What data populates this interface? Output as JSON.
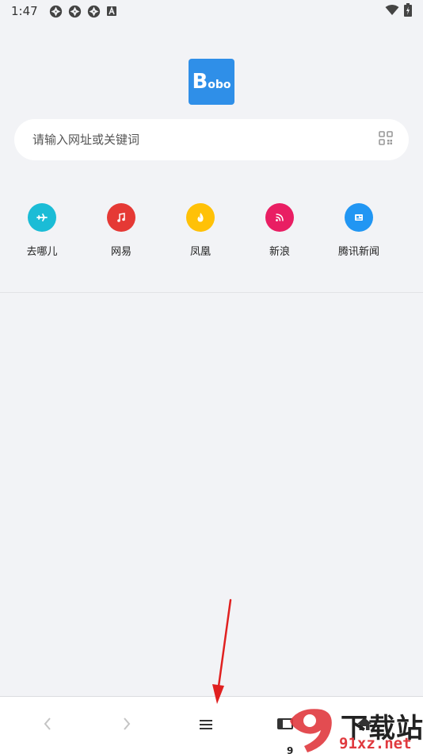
{
  "status_bar": {
    "time": "1:47",
    "left_icons": [
      "aperture-icon",
      "aperture-icon",
      "aperture-icon",
      "a-badge-icon"
    ],
    "right_icons": [
      "wifi-icon",
      "battery-charging-icon"
    ]
  },
  "logo": {
    "text_big": "B",
    "text_small": "obo"
  },
  "search": {
    "placeholder": "请输入网址或关键词",
    "icon": "qr-scan-icon"
  },
  "quick_links": [
    {
      "label": "去哪儿",
      "color": "#1bbcd6",
      "icon": "plane-icon"
    },
    {
      "label": "网易",
      "color": "#e53935",
      "icon": "music-icon"
    },
    {
      "label": "凤凰",
      "color": "#ffc107",
      "icon": "flame-icon"
    },
    {
      "label": "新浪",
      "color": "#e91e63",
      "icon": "rss-icon"
    },
    {
      "label": "腾讯新闻",
      "color": "#2196f3",
      "icon": "news-icon"
    }
  ],
  "bottom_nav": {
    "items": [
      "back-icon",
      "forward-icon",
      "menu-icon",
      "tabs-icon",
      "home-icon"
    ]
  },
  "annotation": {
    "color": "#e02020"
  },
  "watermark": {
    "top_text": "下载站",
    "bottom_text": "91xz.net",
    "number": "9",
    "color": "#e0393e"
  }
}
